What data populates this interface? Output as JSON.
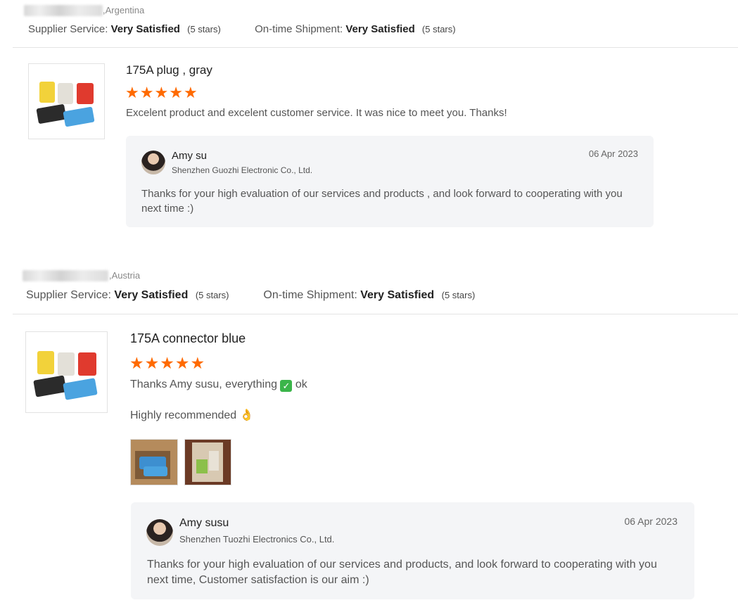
{
  "reviews": [
    {
      "country": ",Argentina",
      "supplier_service_label": "Supplier Service:",
      "supplier_service_value": "Very Satisfied",
      "supplier_service_stars": "(5 stars)",
      "shipment_label": "On-time Shipment:",
      "shipment_value": "Very Satisfied",
      "shipment_stars": "(5 stars)",
      "product_title": "175A plug , gray",
      "rating": 5,
      "comment_lines": [
        "Excelent product and excelent customer service. It was nice to meet you. Thanks!"
      ],
      "reply": {
        "name": "Amy su",
        "company": "Shenzhen Guozhi Electronic Co., Ltd.",
        "date": "06 Apr 2023",
        "message_line1": "Thanks for your high evaluation of our services and products , and look forward to cooperating with you",
        "message_line2": "next time :)"
      }
    },
    {
      "country": ",Austria",
      "supplier_service_label": "Supplier Service:",
      "supplier_service_value": "Very Satisfied",
      "supplier_service_stars": "(5 stars)",
      "shipment_label": "On-time Shipment:",
      "shipment_value": "Very Satisfied",
      "shipment_stars": "(5 stars)",
      "product_title": "175A connector blue",
      "rating": 5,
      "comment_line1_a": "Thanks Amy susu, everything",
      "comment_line1_b": "ok",
      "comment_line2": "Highly recommended 👌",
      "reply": {
        "name": "Amy susu",
        "company": "Shenzhen Tuozhi Electronics Co., Ltd.",
        "date": "06 Apr 2023",
        "message_line1": "Thanks for your high evaluation of our services and products, and look forward to cooperating with you",
        "message_line2": "next time, Customer satisfaction is our aim :)"
      }
    }
  ],
  "icons": {
    "star": "star-icon",
    "check": "check-mark-icon"
  },
  "colors": {
    "star": "#ff6a00",
    "reply_bg": "#f4f5f7",
    "check": "#3bb54a"
  }
}
